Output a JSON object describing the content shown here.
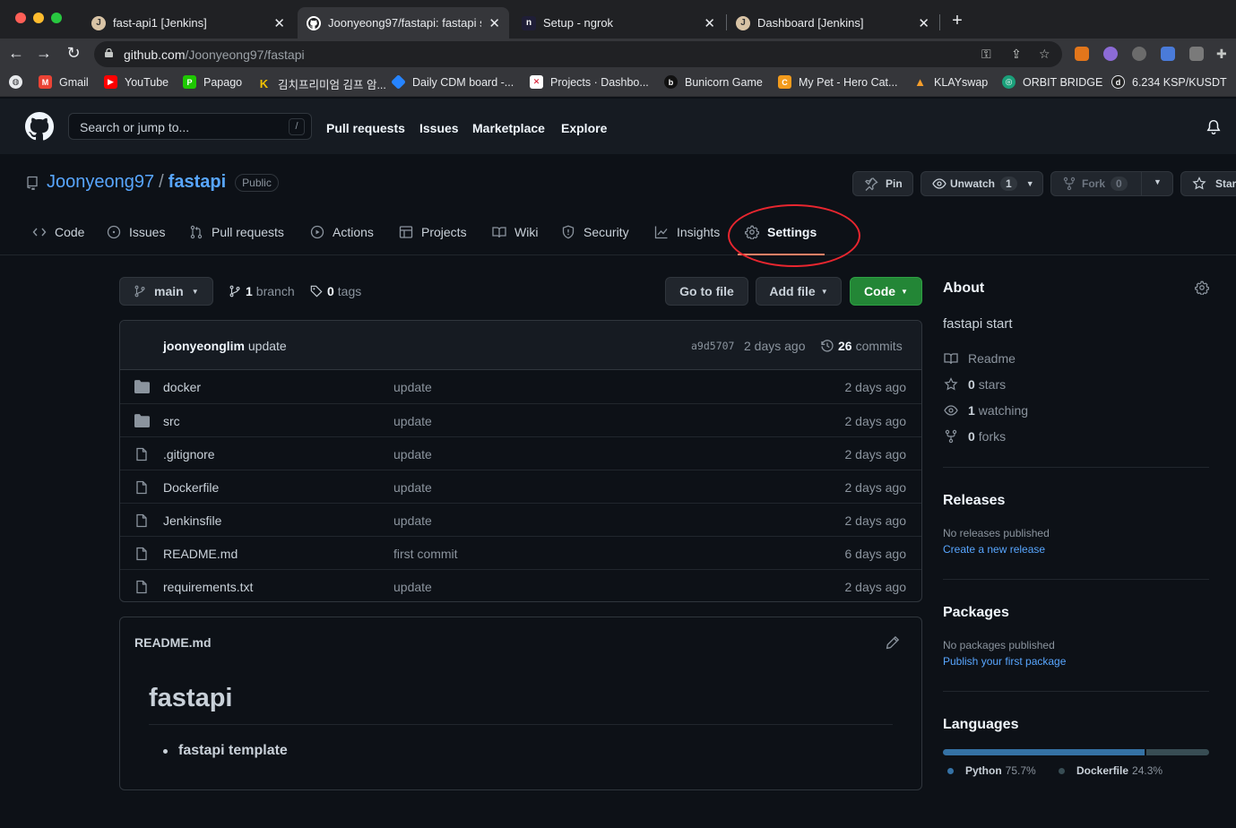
{
  "browser": {
    "tabs": [
      {
        "title": "fast-api1 [Jenkins]",
        "favicon": "jenkins-icon"
      },
      {
        "title": "Joonyeong97/fastapi: fastapi st",
        "favicon": "github-icon"
      },
      {
        "title": "Setup - ngrok",
        "favicon": "ngrok-icon"
      },
      {
        "title": "Dashboard [Jenkins]",
        "favicon": "jenkins-icon"
      }
    ],
    "active_tab": 1,
    "url_host": "github.com",
    "url_path": "/Joonyeong97/fastapi",
    "bookmarks": [
      {
        "label": "",
        "icon": "globe-icon"
      },
      {
        "label": "Gmail",
        "icon": "gmail-icon"
      },
      {
        "label": "YouTube",
        "icon": "youtube-icon"
      },
      {
        "label": "Papago",
        "icon": "papago-icon"
      },
      {
        "label": "김치프리미엄 김프 암...",
        "icon": "kimchi-icon"
      },
      {
        "label": "Daily CDM board -...",
        "icon": "jira-icon"
      },
      {
        "label": "Projects · Dashbo...",
        "icon": "projects-icon"
      },
      {
        "label": "Bunicorn Game",
        "icon": "bunicorn-icon"
      },
      {
        "label": "My Pet - Hero Cat...",
        "icon": "pet-icon"
      },
      {
        "label": "KLAYswap",
        "icon": "klayswap-icon"
      },
      {
        "label": "ORBIT BRIDGE",
        "icon": "orbit-icon"
      },
      {
        "label": "6.234 KSP/KUSDT",
        "icon": "ksp-icon"
      }
    ]
  },
  "github": {
    "search_placeholder": "Search or jump to...",
    "search_shortcut": "/",
    "nav": [
      "Pull requests",
      "Issues",
      "Marketplace",
      "Explore"
    ]
  },
  "repo": {
    "owner": "Joonyeong97",
    "separator": "/",
    "name": "fastapi",
    "visibility": "Public",
    "pin_label": "Pin",
    "unwatch_label": "Unwatch",
    "unwatch_count": "1",
    "fork_label": "Fork",
    "fork_count": "0",
    "star_label": "Star",
    "tabs": [
      "Code",
      "Issues",
      "Pull requests",
      "Actions",
      "Projects",
      "Wiki",
      "Security",
      "Insights",
      "Settings"
    ],
    "selected_tab": "Settings",
    "branch": "main",
    "branch_count": "1",
    "branch_label": "branch",
    "tag_count": "0",
    "tag_label": "tags",
    "goto_file": "Go to file",
    "add_file": "Add file",
    "code_button": "Code",
    "last_commit": {
      "author": "joonyeonglim",
      "message": "update",
      "sha": "a9d5707",
      "age": "2 days ago",
      "commit_count": "26",
      "commit_label": "commits"
    },
    "files": [
      {
        "name": "docker",
        "type": "dir",
        "message": "update",
        "age": "2 days ago"
      },
      {
        "name": "src",
        "type": "dir",
        "message": "update",
        "age": "2 days ago"
      },
      {
        "name": ".gitignore",
        "type": "file",
        "message": "update",
        "age": "2 days ago"
      },
      {
        "name": "Dockerfile",
        "type": "file",
        "message": "update",
        "age": "2 days ago"
      },
      {
        "name": "Jenkinsfile",
        "type": "file",
        "message": "update",
        "age": "2 days ago"
      },
      {
        "name": "README.md",
        "type": "file",
        "message": "first commit",
        "age": "6 days ago"
      },
      {
        "name": "requirements.txt",
        "type": "file",
        "message": "update",
        "age": "2 days ago"
      }
    ],
    "readme": {
      "filename": "README.md",
      "heading": "fastapi",
      "items": [
        "fastapi template"
      ]
    }
  },
  "sidebar": {
    "about_title": "About",
    "description": "fastapi start",
    "readme_label": "Readme",
    "stars_count": "0",
    "stars_label": "stars",
    "watching_count": "1",
    "watching_label": "watching",
    "forks_count": "0",
    "forks_label": "forks",
    "releases_title": "Releases",
    "releases_empty": "No releases published",
    "releases_link": "Create a new release",
    "packages_title": "Packages",
    "packages_empty": "No packages published",
    "packages_link": "Publish your first package",
    "languages_title": "Languages",
    "languages": [
      {
        "name": "Python",
        "percent": "75.7%",
        "value": 75.7,
        "color": "#3572A5"
      },
      {
        "name": "Dockerfile",
        "percent": "24.3%",
        "value": 24.3,
        "color": "#384d54"
      }
    ]
  },
  "colors": {
    "accent_link": "#58a6ff",
    "code_button": "#238636",
    "tab_underline": "#f78166",
    "annotation": "#e8262f"
  }
}
